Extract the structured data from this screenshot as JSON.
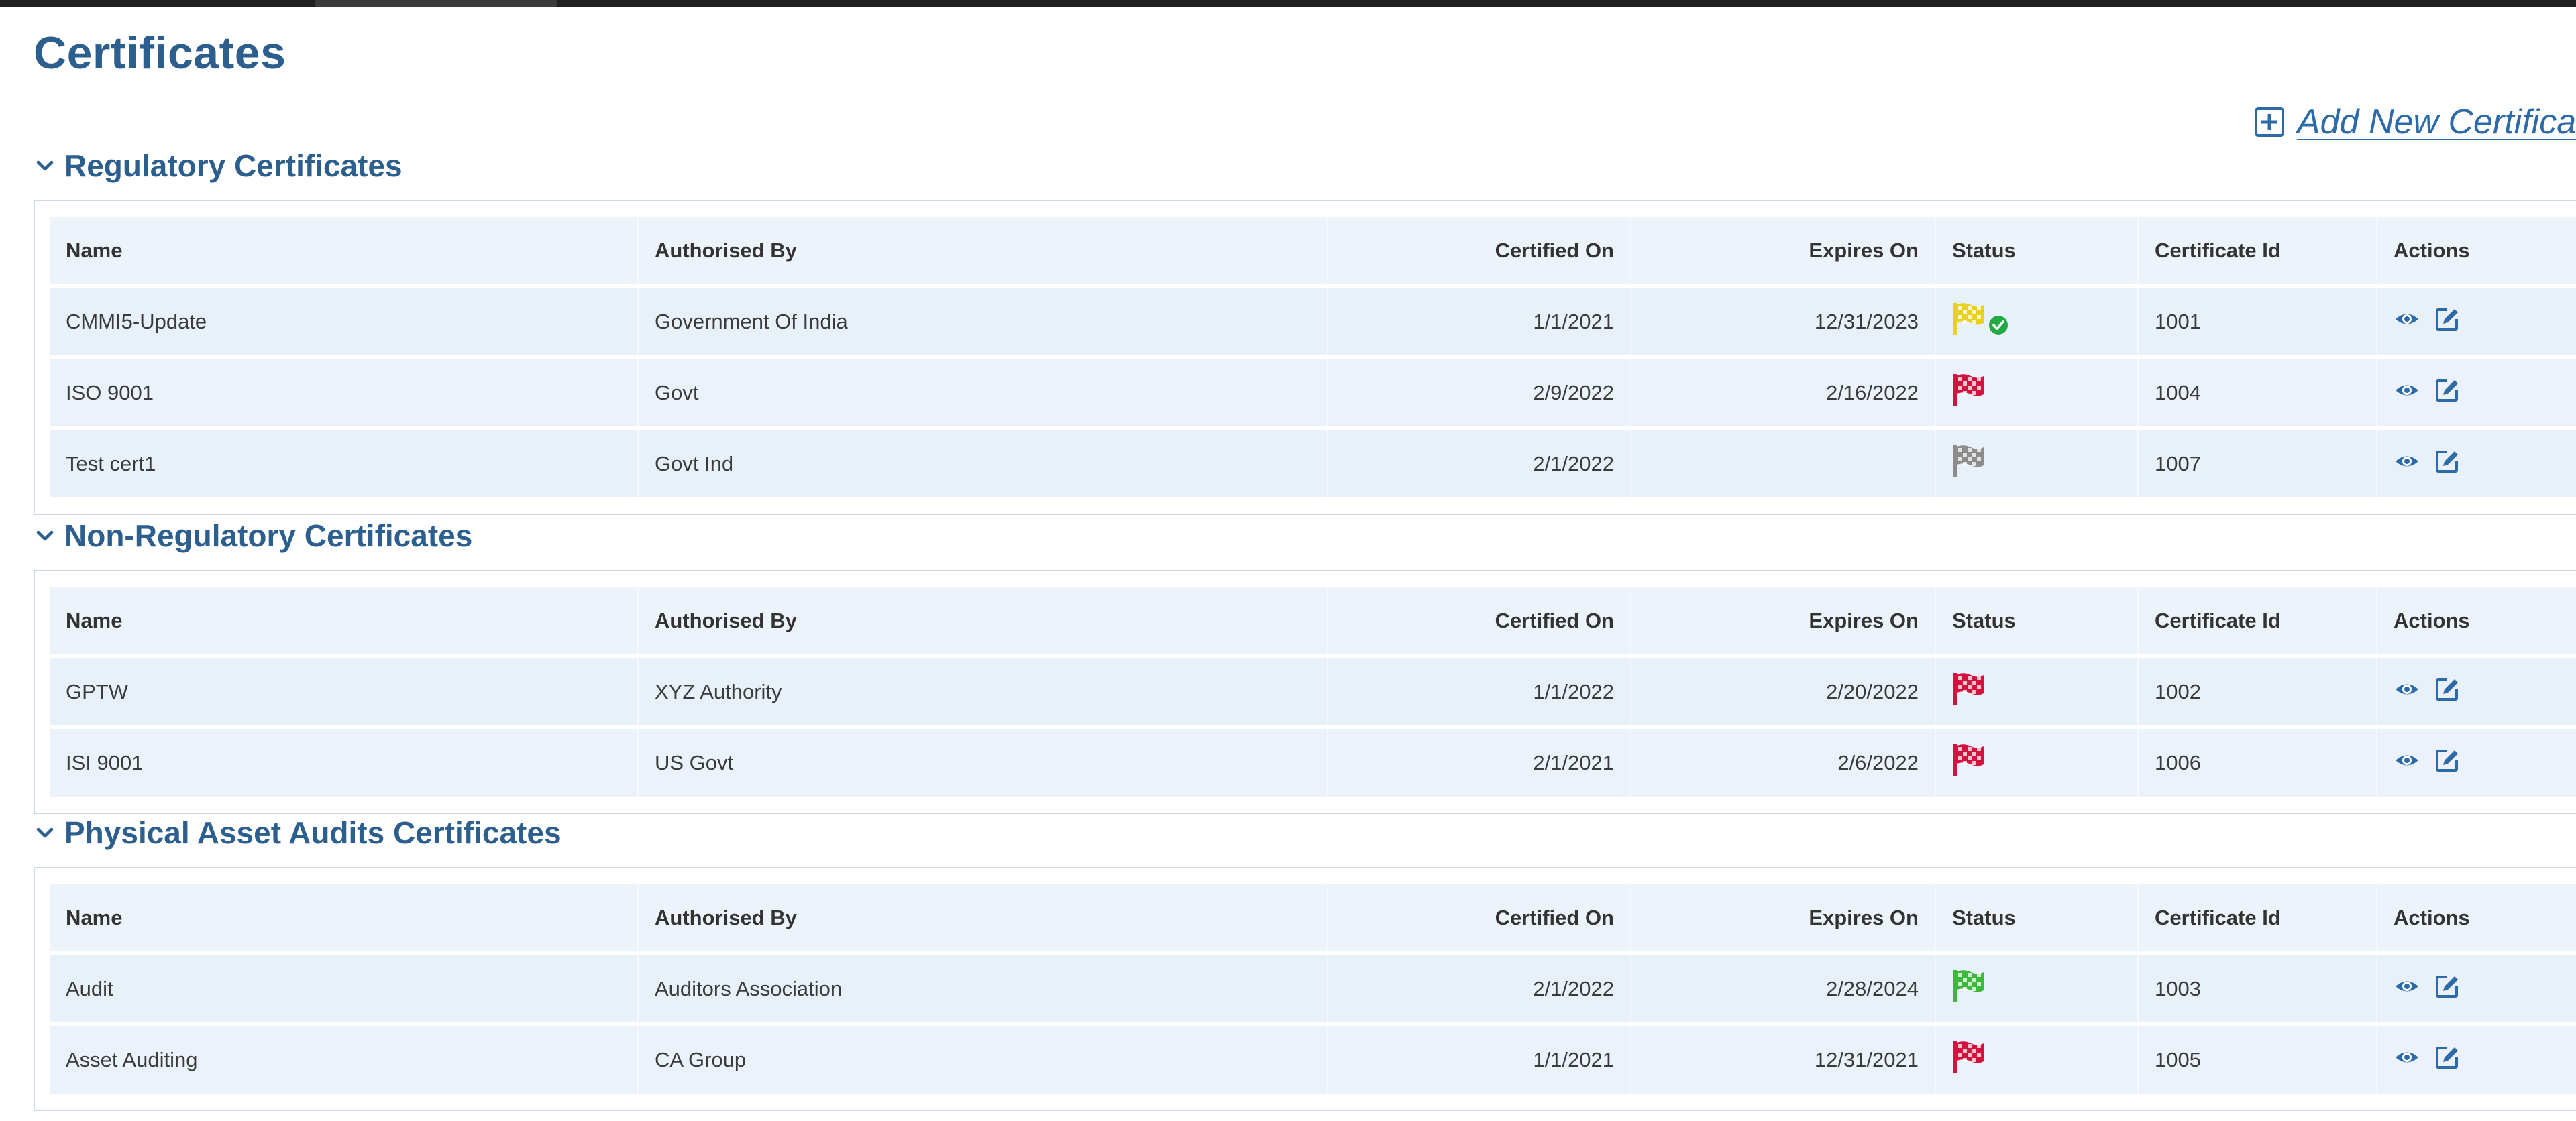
{
  "page": {
    "title": "Certificates",
    "add_button_label": "Add New Certifica"
  },
  "columns": {
    "name": "Name",
    "authorised_by": "Authorised By",
    "certified_on": "Certified On",
    "expires_on": "Expires On",
    "status": "Status",
    "certificate_id": "Certificate Id",
    "actions": "Actions"
  },
  "colors": {
    "heading": "#2c5f8e",
    "link": "#2c6aa8",
    "flag_yellow": "#e8d21c",
    "flag_red": "#d4123f",
    "flag_gray": "#8c8c8c",
    "flag_green": "#3cb83c",
    "check_green": "#22aa44",
    "action_icon": "#2c6aa8"
  },
  "sections": [
    {
      "title": "Regulatory Certificates",
      "rows": [
        {
          "name": "CMMI5-Update",
          "authorised_by": "Government Of India",
          "certified_on": "1/1/2021",
          "expires_on": "12/31/2023",
          "status_flag": "yellow",
          "status_check": true,
          "certificate_id": "1001"
        },
        {
          "name": "ISO 9001",
          "authorised_by": "Govt",
          "certified_on": "2/9/2022",
          "expires_on": "2/16/2022",
          "status_flag": "red",
          "status_check": false,
          "certificate_id": "1004"
        },
        {
          "name": "Test cert1",
          "authorised_by": "Govt Ind",
          "certified_on": "2/1/2022",
          "expires_on": "",
          "status_flag": "gray",
          "status_check": false,
          "certificate_id": "1007"
        }
      ]
    },
    {
      "title": "Non-Regulatory Certificates",
      "rows": [
        {
          "name": "GPTW",
          "authorised_by": "XYZ Authority",
          "certified_on": "1/1/2022",
          "expires_on": "2/20/2022",
          "status_flag": "red",
          "status_check": false,
          "certificate_id": "1002"
        },
        {
          "name": "ISI 9001",
          "authorised_by": "US Govt",
          "certified_on": "2/1/2021",
          "expires_on": "2/6/2022",
          "status_flag": "red",
          "status_check": false,
          "certificate_id": "1006"
        }
      ]
    },
    {
      "title": "Physical Asset Audits Certificates",
      "rows": [
        {
          "name": "Audit",
          "authorised_by": "Auditors Association",
          "certified_on": "2/1/2022",
          "expires_on": "2/28/2024",
          "status_flag": "green",
          "status_check": false,
          "certificate_id": "1003"
        },
        {
          "name": "Asset Auditing",
          "authorised_by": "CA Group",
          "certified_on": "1/1/2021",
          "expires_on": "12/31/2021",
          "status_flag": "red",
          "status_check": false,
          "certificate_id": "1005"
        }
      ]
    }
  ]
}
